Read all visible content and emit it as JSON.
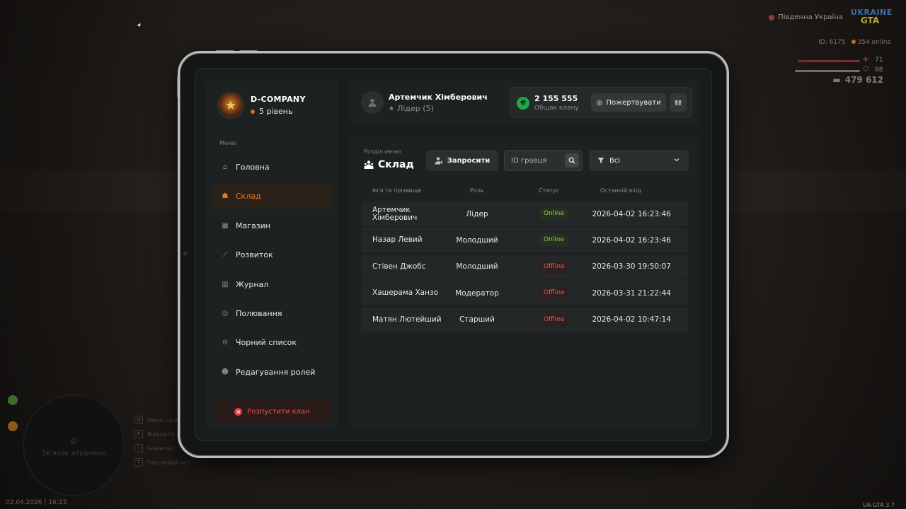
{
  "hud": {
    "region": "Південна Україна",
    "logo_top": "UKRAINE",
    "logo_bottom": "GTA",
    "player_id": "ID: 6175",
    "online": "354 online",
    "health": "71",
    "armor": "88",
    "money": "479 612",
    "minimap_text": "Зв'язок втрачено",
    "datetime": "02.04.2026 | 16:23",
    "version": "UA-GTA 3.7",
    "keys": [
      {
        "key": "O",
        "label": "Меню гравця"
      },
      {
        "key": "P",
        "label": "Відкрити телефон"
      },
      {
        "key": "I",
        "label": "Інвентар"
      },
      {
        "key": "T",
        "label": "Текстовий чат"
      }
    ]
  },
  "sidebar": {
    "org_name": "D-COMPANY",
    "org_level": "5 рівень",
    "menu_caption": "Меню",
    "items": [
      {
        "label": "Головна",
        "icon": "home-icon",
        "glyph": "⌂"
      },
      {
        "label": "Склад",
        "icon": "members-icon",
        "glyph": "☗"
      },
      {
        "label": "Магазин",
        "icon": "shop-icon",
        "glyph": "▦"
      },
      {
        "label": "Розвиток",
        "icon": "chart-icon",
        "glyph": "⟋"
      },
      {
        "label": "Журнал",
        "icon": "book-icon",
        "glyph": "▥"
      },
      {
        "label": "Полювання",
        "icon": "target-icon",
        "glyph": "◎"
      },
      {
        "label": "Чорний список",
        "icon": "block-icon",
        "glyph": "⊖"
      },
      {
        "label": "Редагування ролей",
        "icon": "user-edit-icon",
        "glyph": "☻"
      }
    ],
    "disband_label": "Розпустити клан"
  },
  "header": {
    "user_name": "Артемчик Хімберович",
    "user_role": "Лідер (5)",
    "money_value": "2 155 555",
    "money_label": "Общак клану",
    "donate_label": "Пожертвувати"
  },
  "main": {
    "section_caption": "Розділ меню",
    "section_title": "Склад",
    "invite_label": "Запросити",
    "search_placeholder": "ID гравця",
    "filter_label": "Всі",
    "columns": [
      "Ім'я та прізвище",
      "Роль",
      "Статус",
      "Останній вхід"
    ],
    "rows": [
      {
        "name": "Артемчик Хімберович",
        "role": "Лідер",
        "status": "Online",
        "last": "2026-04-02 16:23:46"
      },
      {
        "name": "Назар Левий",
        "role": "Молодший",
        "status": "Online",
        "last": "2026-04-02 16:23:46"
      },
      {
        "name": "Стівен Джобс",
        "role": "Молодший",
        "status": "Offline",
        "last": "2026-03-30 19:50:07"
      },
      {
        "name": "Хашерама Ханзо",
        "role": "Модератор",
        "status": "Offline",
        "last": "2026-03-31 21:22:44"
      },
      {
        "name": "Матян Лютейший",
        "role": "Старший",
        "status": "Offline",
        "last": "2026-04-02 10:47:14"
      }
    ]
  },
  "colors": {
    "accent": "#ee7526",
    "online": "#8fd04a",
    "offline": "#e25a52",
    "money": "#22a64a",
    "danger": "#e03d3d"
  }
}
